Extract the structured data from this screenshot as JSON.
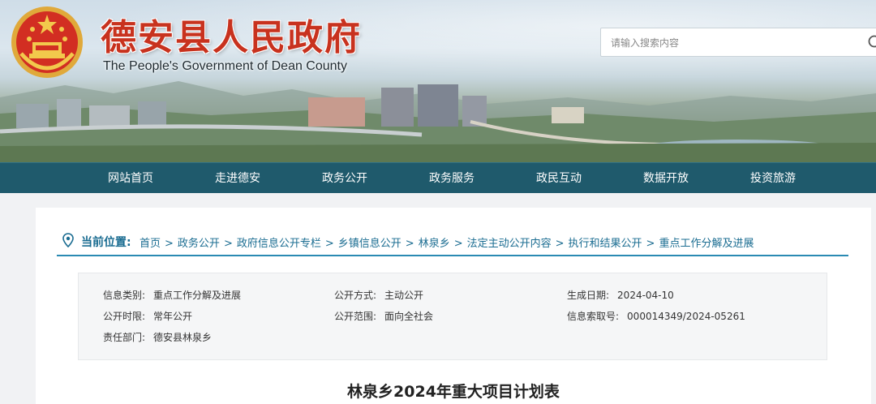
{
  "header": {
    "title": "德安县人民政府",
    "subtitle": "The People's Government of Dean County",
    "emblem_icon": "national-emblem-icon",
    "search_placeholder": "请输入搜索内容",
    "search_icon": "search-icon"
  },
  "nav": {
    "items": [
      {
        "label": "网站首页"
      },
      {
        "label": "走进德安"
      },
      {
        "label": "政务公开"
      },
      {
        "label": "政务服务"
      },
      {
        "label": "政民互动"
      },
      {
        "label": "数据开放"
      },
      {
        "label": "投资旅游"
      }
    ]
  },
  "breadcrumb": {
    "icon": "location-pin-icon",
    "label": "当前位置:",
    "items": [
      "首页",
      "政务公开",
      "政府信息公开专栏",
      "乡镇信息公开",
      "林泉乡",
      "法定主动公开内容",
      "执行和结果公开",
      "重点工作分解及进展"
    ],
    "separator": ">"
  },
  "meta": {
    "category_key": "信息类别:",
    "category_val": "重点工作分解及进展",
    "method_key": "公开方式:",
    "method_val": "主动公开",
    "date_key": "生成日期:",
    "date_val": "2024-04-10",
    "period_key": "公开时限:",
    "period_val": "常年公开",
    "scope_key": "公开范围:",
    "scope_val": "面向全社会",
    "index_key": "信息索取号:",
    "index_val": "000014349/2024-05261",
    "dept_key": "责任部门:",
    "dept_val": "德安县林泉乡"
  },
  "document": {
    "title": "林泉乡2024年重大项目计划表"
  },
  "colors": {
    "nav_bg": "#1f5a6c",
    "title_red": "#c8321e",
    "link_blue": "#1a6c91",
    "divider_blue": "#2a8ab3"
  }
}
